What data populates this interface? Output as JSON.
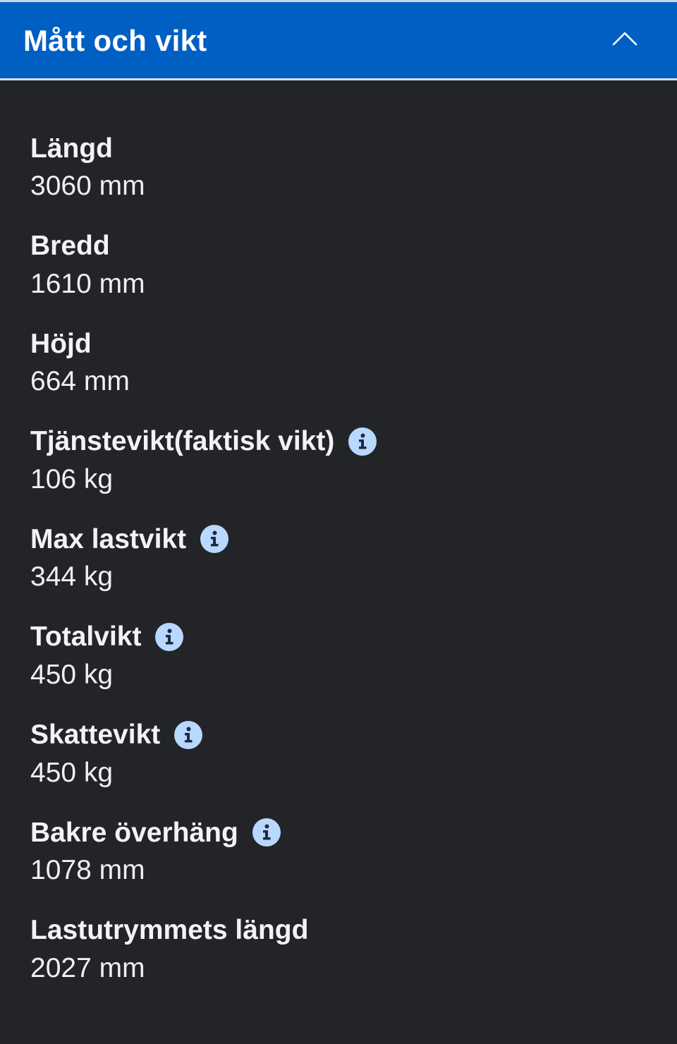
{
  "section": {
    "title": "Mått och vikt",
    "expanded": true
  },
  "specs": [
    {
      "label": "Längd",
      "value": "3060 mm",
      "has_info": false
    },
    {
      "label": "Bredd",
      "value": "1610 mm",
      "has_info": false
    },
    {
      "label": "Höjd",
      "value": "664 mm",
      "has_info": false
    },
    {
      "label": "Tjänstevikt(faktisk vikt)",
      "value": "106 kg",
      "has_info": true
    },
    {
      "label": "Max lastvikt",
      "value": "344 kg",
      "has_info": true
    },
    {
      "label": "Totalvikt",
      "value": "450 kg",
      "has_info": true
    },
    {
      "label": "Skattevikt",
      "value": "450 kg",
      "has_info": true
    },
    {
      "label": "Bakre överhäng",
      "value": "1078 mm",
      "has_info": true
    },
    {
      "label": "Lastutrymmets längd",
      "value": "2027 mm",
      "has_info": false
    }
  ],
  "colors": {
    "header_bg": "#005fc2",
    "page_bg": "#232427",
    "info_icon_bg": "#b9d8ff",
    "info_icon_fg": "#1c2a40"
  },
  "icons": {
    "collapse": "chevron-up-icon",
    "info": "info-icon"
  }
}
